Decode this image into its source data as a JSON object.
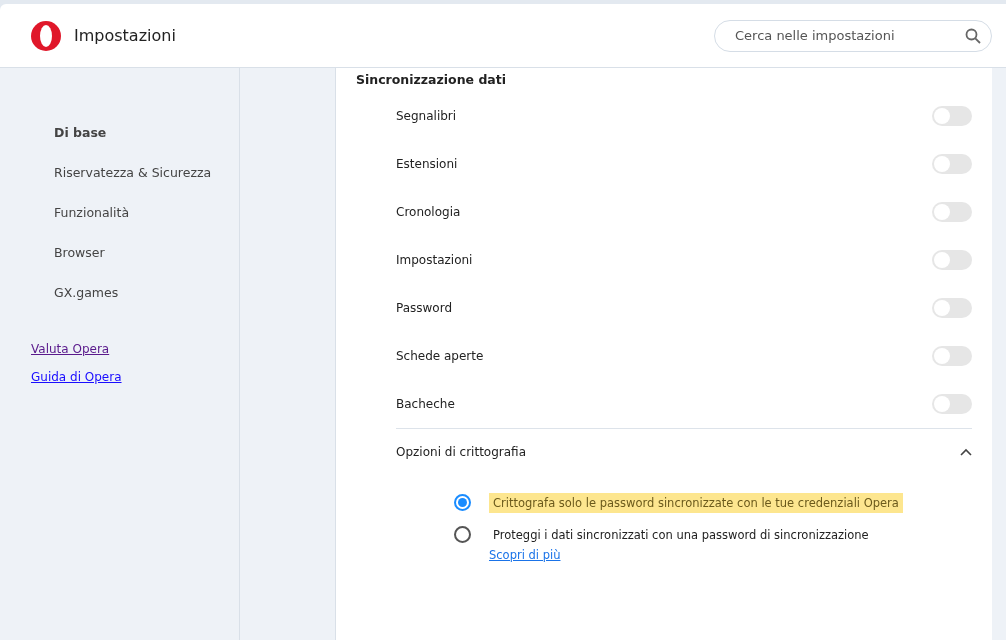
{
  "header": {
    "title": "Impostazioni",
    "search": {
      "placeholder": "Cerca nelle impostazioni"
    }
  },
  "sidebar": {
    "items": [
      {
        "label": "Di base",
        "selected": true
      },
      {
        "label": "Riservatezza & Sicurezza",
        "selected": false
      },
      {
        "label": "Funzionalità",
        "selected": false
      },
      {
        "label": "Browser",
        "selected": false
      },
      {
        "label": "GX.games",
        "selected": false
      }
    ],
    "links": [
      {
        "label": "Valuta Opera",
        "visited": true
      },
      {
        "label": "Guida di Opera",
        "visited": false
      }
    ]
  },
  "section": {
    "title": "Sincronizzazione dati",
    "toggles": [
      {
        "label": "Segnalibri",
        "on": false
      },
      {
        "label": "Estensioni",
        "on": false
      },
      {
        "label": "Cronologia",
        "on": false
      },
      {
        "label": "Impostazioni",
        "on": false
      },
      {
        "label": "Password",
        "on": false
      },
      {
        "label": "Schede aperte",
        "on": false
      },
      {
        "label": "Bacheche",
        "on": false
      }
    ],
    "encryption": {
      "title": "Opzioni di crittografia",
      "expanded": true,
      "options": [
        {
          "label": "Crittografa solo le password sincronizzate con le tue credenziali Opera",
          "selected": true,
          "highlighted": true
        },
        {
          "label": "Proteggi i dati sincronizzati con una password di sincronizzazione",
          "selected": false,
          "highlighted": false,
          "link": "Scopri di più"
        }
      ]
    }
  }
}
